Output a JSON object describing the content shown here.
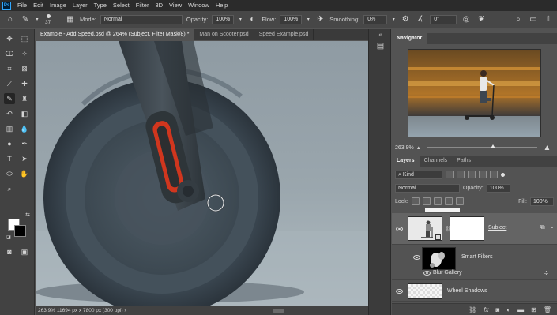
{
  "menu": {
    "logo": "Ps",
    "items": [
      "File",
      "Edit",
      "Image",
      "Layer",
      "Type",
      "Select",
      "Filter",
      "3D",
      "View",
      "Window",
      "Help"
    ]
  },
  "options": {
    "brush_size": "37",
    "mode_label": "Mode:",
    "mode_value": "Normal",
    "opacity_label": "Opacity:",
    "opacity_value": "100%",
    "flow_label": "Flow:",
    "flow_value": "100%",
    "smoothing_label": "Smoothing:",
    "smoothing_value": "0%",
    "angle_value": "0°"
  },
  "documents": {
    "tabs": [
      "Example - Add Speed.psd @ 264% (Subject, Filter Mask/8) *",
      "Man on Scooter.psd",
      "Speed Example.psd"
    ]
  },
  "status": {
    "text": "263.9%   11694 px x 7800 px (300 ppi)   ›"
  },
  "navigator": {
    "tab_label": "Navigator",
    "zoom": "263.9%",
    "zoom_fraction": 0.6
  },
  "layers_panel": {
    "tabs": [
      "Layers",
      "Channels",
      "Paths"
    ],
    "filter_value": "Kind",
    "blend_mode": "Normal",
    "opacity_label": "Opacity:",
    "opacity_value": "100%",
    "lock_label": "Lock:",
    "fill_label": "Fill:",
    "fill_value": "100%",
    "layers": [
      {
        "name": "Subject",
        "selected": true
      },
      {
        "name": "Smart Filters",
        "selected": false
      },
      {
        "name": "Blur Gallery",
        "selected": false
      },
      {
        "name": "Wheel Shadows",
        "selected": false
      }
    ]
  },
  "colors": {
    "accent": "#31a8ff",
    "menubar": "#2b2b2b",
    "panel": "#535353"
  }
}
